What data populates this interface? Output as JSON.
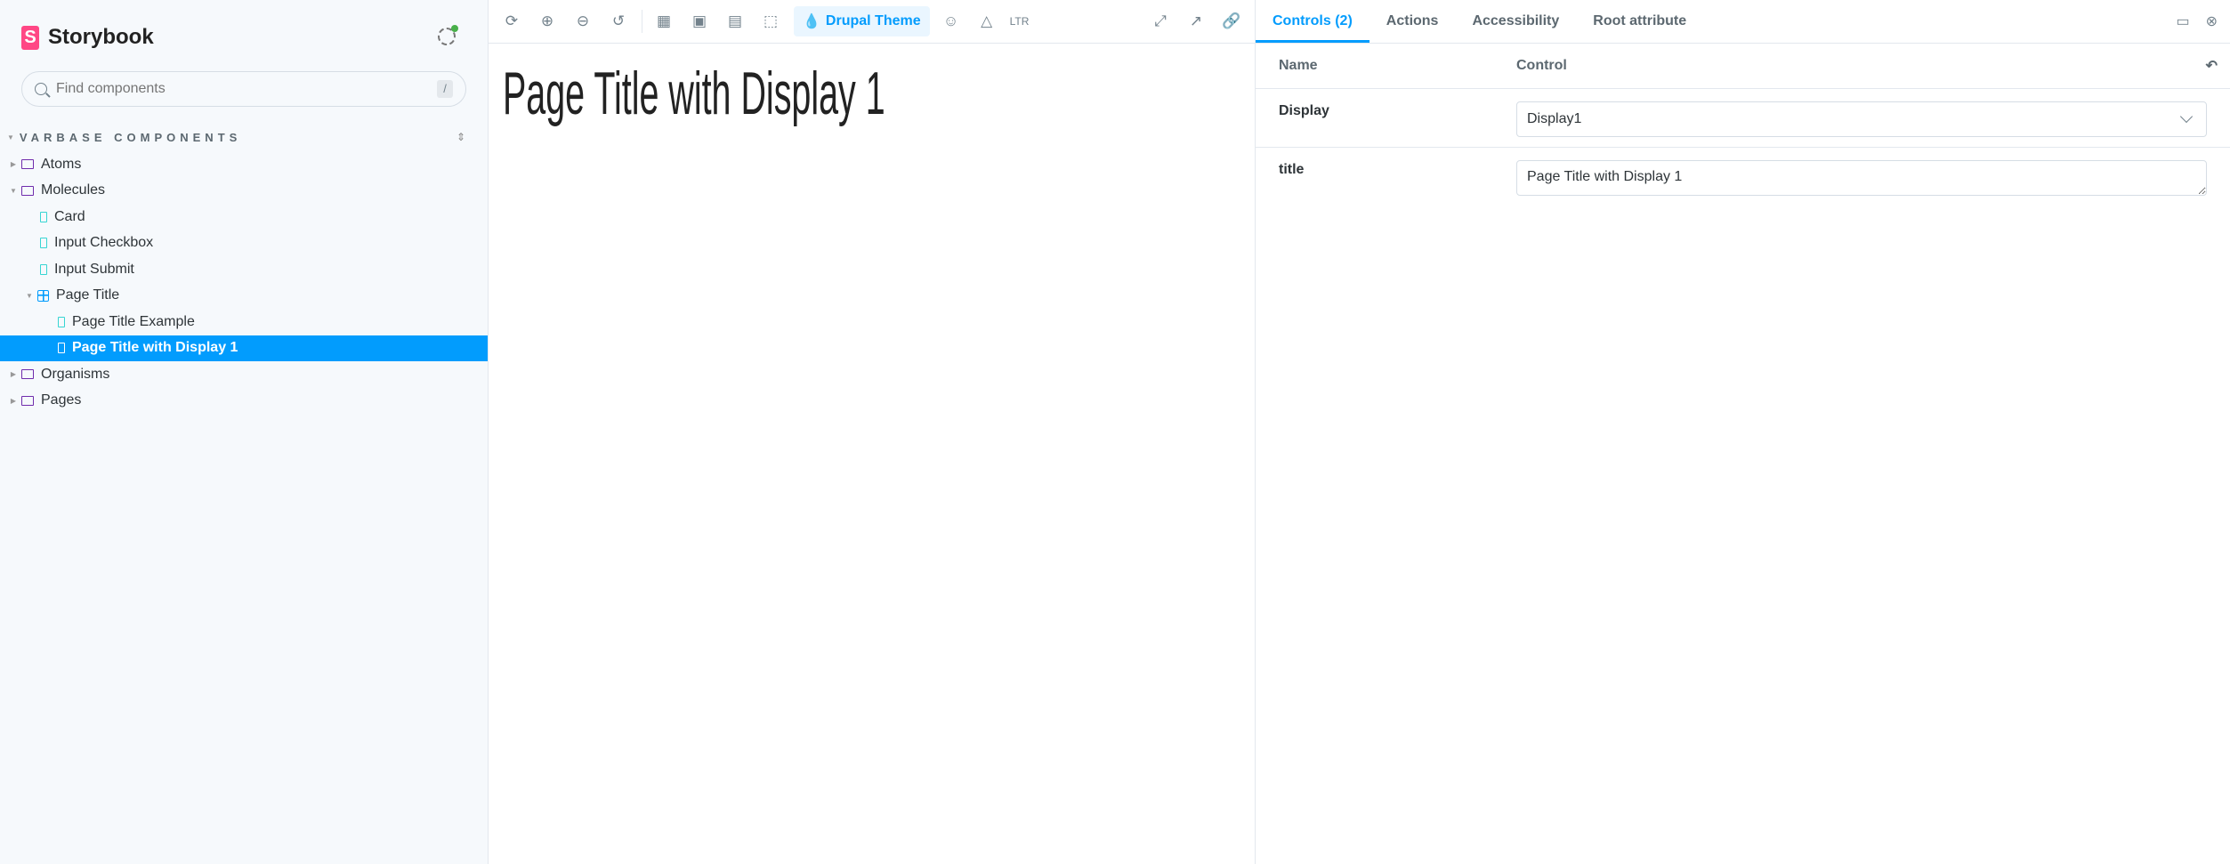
{
  "sidebar": {
    "brand": "Storybook",
    "search": {
      "placeholder": "Find components",
      "shortcut": "/"
    },
    "section": "VARBASE COMPONENTS",
    "tree": [
      {
        "label": "Atoms",
        "type": "folder",
        "expanded": false
      },
      {
        "label": "Molecules",
        "type": "folder",
        "expanded": true
      },
      {
        "label": "Card",
        "type": "story"
      },
      {
        "label": "Input Checkbox",
        "type": "story"
      },
      {
        "label": "Input Submit",
        "type": "story"
      },
      {
        "label": "Page Title",
        "type": "component",
        "expanded": true
      },
      {
        "label": "Page Title Example",
        "type": "story"
      },
      {
        "label": "Page Title with Display 1",
        "type": "story",
        "selected": true
      },
      {
        "label": "Organisms",
        "type": "folder",
        "expanded": false
      },
      {
        "label": "Pages",
        "type": "folder",
        "expanded": false
      }
    ]
  },
  "toolbar": {
    "theme_label": "Drupal Theme",
    "direction": "LTR"
  },
  "canvas": {
    "title": "Page Title with Display 1"
  },
  "panel": {
    "tabs": [
      "Controls (2)",
      "Actions",
      "Accessibility",
      "Root attribute"
    ],
    "headers": {
      "name": "Name",
      "control": "Control"
    },
    "rows": [
      {
        "name": "Display",
        "value": "Display1"
      },
      {
        "name": "title",
        "value": "Page Title with Display 1"
      }
    ]
  },
  "colors": {
    "accent": "#029cfd",
    "brand": "#ff4785"
  }
}
